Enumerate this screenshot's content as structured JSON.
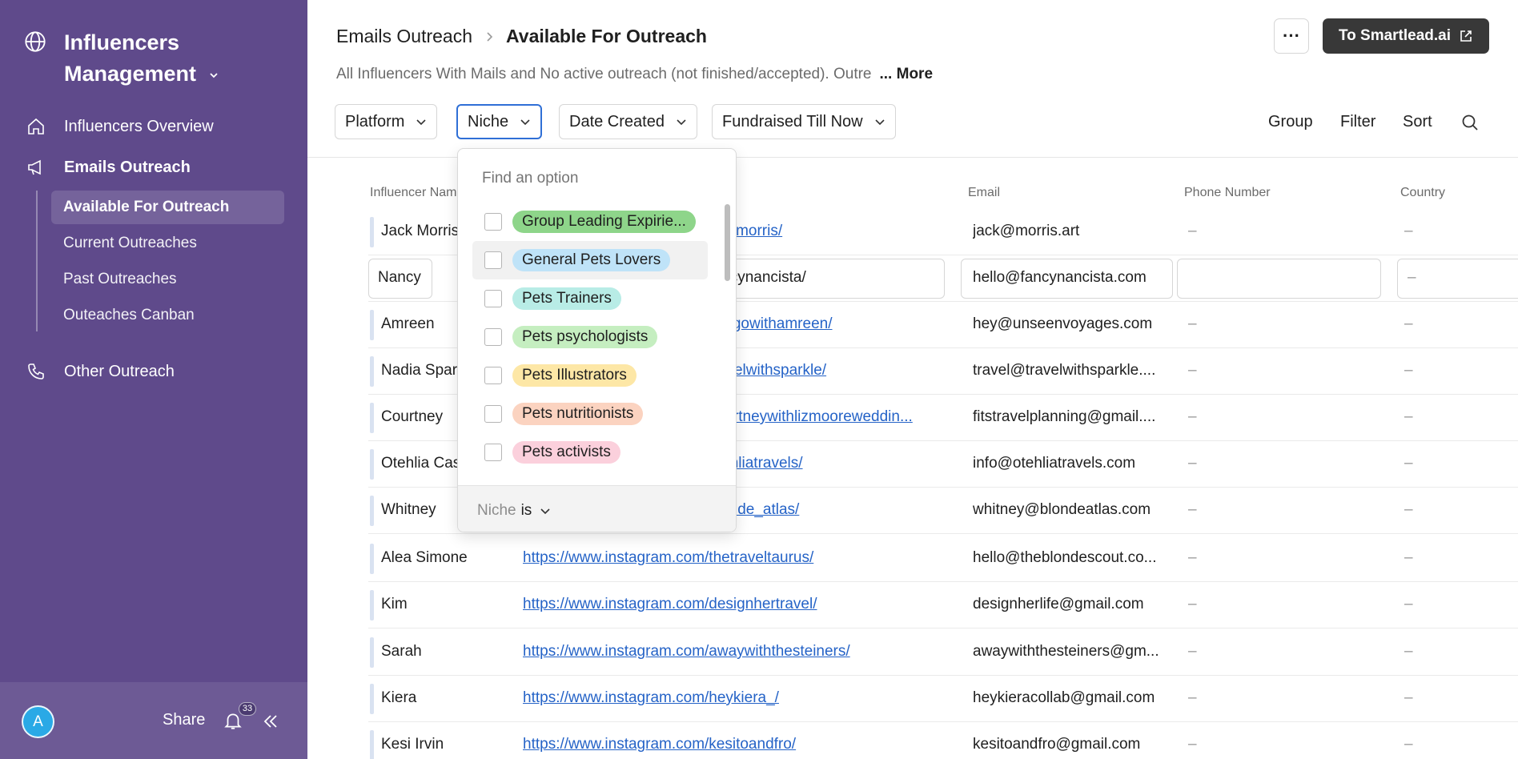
{
  "sidebar": {
    "workspace_title": "Influencers Management",
    "nav": [
      {
        "label": "Influencers Overview",
        "icon": "home-icon"
      },
      {
        "label": "Emails Outreach",
        "icon": "megaphone-icon"
      },
      {
        "label": "Other Outreach",
        "icon": "phone-icon"
      }
    ],
    "sub_items": [
      {
        "label": "Available For Outreach",
        "active": true
      },
      {
        "label": "Current Outreaches"
      },
      {
        "label": "Past Outreaches"
      },
      {
        "label": "Outeaches Canban"
      }
    ],
    "footer": {
      "avatar_letter": "A",
      "share_label": "Share",
      "notification_count": "33"
    }
  },
  "header": {
    "breadcrumb_parent": "Emails Outreach",
    "breadcrumb_current": "Available For Outreach",
    "description": "All Influencers With Mails and No active outreach (not finished/accepted). Outre",
    "more_label": "... More",
    "dots_label": "···",
    "smartlead_label": "To Smartlead.ai"
  },
  "filters": {
    "platform": "Platform",
    "niche": "Niche",
    "date_created": "Date Created",
    "fundraised": "Fundraised Till Now",
    "group": "Group",
    "filter": "Filter",
    "sort": "Sort"
  },
  "table": {
    "columns": {
      "name": "Influencer Name",
      "email": "Email",
      "phone": "Phone Number",
      "country": "Country"
    },
    "rows": [
      {
        "name": "Jack Morris",
        "link": "https://www.instagram.com/jackmorris/",
        "email": "jack@morris.art",
        "phone": "–",
        "country": "–"
      },
      {
        "name": "Nancy",
        "link": "https://www.instagram.com/fancynancista/",
        "email": "hello@fancynancista.com",
        "phone": "",
        "country": "–"
      },
      {
        "name": "Amreen",
        "link": "https://www.instagram.com/justgowithamreen/",
        "email": "hey@unseenvoyages.com",
        "phone": "–",
        "country": "–"
      },
      {
        "name": "Nadia Sparkle",
        "link": "https://www.instagram.com/travelwithsparkle/",
        "email": "travel@travelwithsparkle....",
        "phone": "–",
        "country": "–"
      },
      {
        "name": "Courtney",
        "link": "https://www.instagram.com/courtneywithlizmooreweddin...",
        "email": "fitstravelplanning@gmail....",
        "phone": "–",
        "country": "–"
      },
      {
        "name": "Otehlia Cas",
        "link": "https://www.instagram.com/otehliatravels/",
        "email": "info@otehliatravels.com",
        "phone": "–",
        "country": "–"
      },
      {
        "name": "Whitney",
        "link": "https://www.instagram.com/blonde_atlas/",
        "email": "whitney@blondeatlas.com",
        "phone": "–",
        "country": "–"
      },
      {
        "name": "Alea Simone",
        "link": "https://www.instagram.com/thetraveltaurus/",
        "email": "hello@theblondescout.co...",
        "phone": "–",
        "country": "–"
      },
      {
        "name": "Kim",
        "link": "https://www.instagram.com/designhertravel/",
        "email": "designherlife@gmail.com",
        "phone": "–",
        "country": "–"
      },
      {
        "name": "Sarah",
        "link": "https://www.instagram.com/awaywiththesteiners/",
        "email": "awaywiththesteiners@gm...",
        "phone": "–",
        "country": "–"
      },
      {
        "name": "Kiera",
        "link": "https://www.instagram.com/heykiera_/",
        "email": "heykieracollab@gmail.com",
        "phone": "–",
        "country": "–"
      },
      {
        "name": "Kesi Irvin",
        "link": "https://www.instagram.com/kesitoandfro/",
        "email": "kesitoandfro@gmail.com",
        "phone": "–",
        "country": "–"
      }
    ],
    "visible_fragments": {
      "row0_link": "ackmorris/",
      "row1_link": "ancynancista/",
      "row2_link": "ustgowithamreen/",
      "row3_link": "ravelwithsparkle/",
      "row4_link": "courtneywithlizmooreweddin...",
      "row5_link": "otehliatravels/",
      "row6_link": "blonde_atlas/",
      "row0_name": "Jack Morris",
      "row3_name": "Nadia Spar",
      "row5_name": "Otehlia Cas"
    }
  },
  "dropdown": {
    "search_placeholder": "Find an option",
    "options": [
      {
        "label": "Group Leading Expirie...",
        "color": "#8ed58a"
      },
      {
        "label": "General Pets Lovers",
        "color": "#bfe3f8"
      },
      {
        "label": "Pets Trainers",
        "color": "#b8ece6"
      },
      {
        "label": "Pets psychologists",
        "color": "#c5eec0"
      },
      {
        "label": "Pets Illustrators",
        "color": "#fde7a6"
      },
      {
        "label": "Pets nutritionists",
        "color": "#fbd3c0"
      },
      {
        "label": "Pets activists",
        "color": "#fbd0dc"
      }
    ],
    "footer_field": "Niche",
    "footer_operator": "is"
  }
}
